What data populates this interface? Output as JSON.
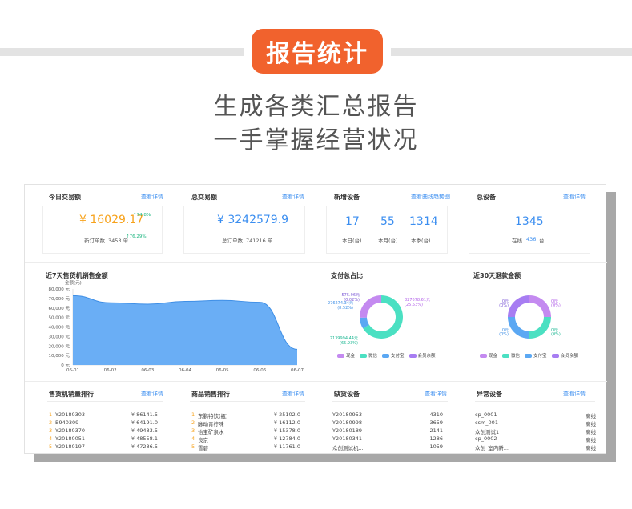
{
  "header": {
    "badge": "报告统计",
    "line1": "生成各类汇总报告",
    "line2": "一手掌握经营状况"
  },
  "stats": {
    "today": {
      "title": "今日交易额",
      "link": "查看详情",
      "amount": "¥ 16029.17",
      "up": "↑74.8%",
      "orders_label": "新订单数",
      "orders": "3453 单",
      "orders_up": "↑76.29%"
    },
    "total": {
      "title": "总交易额",
      "link": "查看详情",
      "amount": "¥ 3242579.9",
      "orders_label": "总订单数",
      "orders": "741216 单"
    },
    "new_devices": {
      "title": "新增设备",
      "link": "查看曲线趋势图",
      "values": [
        "17",
        "55",
        "1314"
      ],
      "labels": [
        "本日(台)",
        "本月(台)",
        "本季(台)"
      ]
    },
    "all_devices": {
      "title": "总设备",
      "link": "查看详情",
      "value": "1345",
      "online_label": "在线",
      "online": "436",
      "unit": "台"
    }
  },
  "sales_chart": {
    "title": "近7天售货机销售金额",
    "unit_label": "金额(元)",
    "y_ticks": [
      "80,000 元",
      "70,000 元",
      "60,000 元",
      "50,000 元",
      "40,000 元",
      "30,000 元",
      "20,000 元",
      "10,000 元",
      "0 元"
    ],
    "x_ticks": [
      "06-01",
      "06-02",
      "06-03",
      "06-04",
      "06-05",
      "06-06",
      "06-07"
    ]
  },
  "chart_data": [
    {
      "type": "area",
      "title": "近7天售货机销售金额",
      "ylabel": "金额(元)",
      "categories": [
        "06-01",
        "06-02",
        "06-03",
        "06-04",
        "06-05",
        "06-06",
        "06-07"
      ],
      "values": [
        73000,
        65500,
        64000,
        67000,
        68000,
        66000,
        16500
      ],
      "ylim": [
        0,
        80000
      ],
      "color": "#6aaef5"
    },
    {
      "type": "pie",
      "title": "支付总占比",
      "labels": [
        "现金",
        "微信",
        "支付宝",
        "会员余额"
      ],
      "values": [
        575.96,
        2139994.44,
        276274.34,
        827678.61
      ],
      "data_labels": [
        "575.96元 (0.02%)",
        "2139994.44元 (65.93%)",
        "276274.34元 (8.52%)",
        "827678.61元 (25.53%)"
      ],
      "colors": [
        "#a77df2",
        "#4be0c2",
        "#5ba8f3",
        "#c48af0"
      ]
    },
    {
      "type": "pie",
      "title": "近30天退款金额",
      "labels": [
        "现金",
        "微信",
        "支付宝",
        "会员余额"
      ],
      "values": [
        0.25,
        0.25,
        0.25,
        0.25
      ],
      "data_labels": [
        "0元 (0%)",
        "0元 (0%)",
        "0元 (0%)",
        "0元 (0%)"
      ],
      "colors": [
        "#c48af0",
        "#4be0c2",
        "#5ba8f3",
        "#a77df2"
      ]
    }
  ],
  "pie_pay": {
    "title": "支付总占比",
    "labels": [
      "575.96元",
      "(0.02%)",
      "276274.34元",
      "(8.52%)",
      "827678.61元",
      "(25.53%)",
      "2139994.44元",
      "(65.93%)"
    ],
    "legend": [
      "现金",
      "微信",
      "支付宝",
      "会员余额"
    ]
  },
  "pie_refund": {
    "title": "近30天退款金额",
    "labels": [
      "0元",
      "(0%)",
      "0元",
      "(0%)",
      "0元",
      "(0%)",
      "0元",
      "(0%)"
    ],
    "legend": [
      "现金",
      "微信",
      "支付宝",
      "会员余额"
    ]
  },
  "rank_machines": {
    "title": "售货机销量排行",
    "link": "查看详情",
    "rows": [
      {
        "rank": "1",
        "name": "Y20180303",
        "value": "¥ 86141.5"
      },
      {
        "rank": "2",
        "name": "B940309",
        "value": "¥ 64191.0"
      },
      {
        "rank": "3",
        "name": "Y20180370",
        "value": "¥ 49483.5"
      },
      {
        "rank": "4",
        "name": "Y20180051",
        "value": "¥ 48558.1"
      },
      {
        "rank": "5",
        "name": "Y20180197",
        "value": "¥ 47286.5"
      }
    ]
  },
  "rank_products": {
    "title": "商品销售排行",
    "link": "查看详情",
    "rows": [
      {
        "rank": "1",
        "name": "东鹏特饮(瓶)",
        "value": "¥ 25102.0"
      },
      {
        "rank": "2",
        "name": "脉动青柠味",
        "value": "¥ 16112.0"
      },
      {
        "rank": "3",
        "name": "怡宝矿泉水",
        "value": "¥ 15378.0"
      },
      {
        "rank": "4",
        "name": "良京",
        "value": "¥ 12784.0"
      },
      {
        "rank": "5",
        "name": "雪碧",
        "value": "¥ 11761.0"
      }
    ]
  },
  "stock_out": {
    "title": "缺货设备",
    "link": "查看详情",
    "rows": [
      {
        "name": "Y20180953",
        "value": "4310"
      },
      {
        "name": "Y20180998",
        "value": "3659"
      },
      {
        "name": "Y20180189",
        "value": "2141"
      },
      {
        "name": "Y20180341",
        "value": "1286"
      },
      {
        "name": "众创测试机...",
        "value": "1059"
      }
    ]
  },
  "abnormal": {
    "title": "异常设备",
    "link": "查看详情",
    "rows": [
      {
        "name": "cp_0001",
        "status": "离线"
      },
      {
        "name": "csm_001",
        "status": "离线"
      },
      {
        "name": "众创测试1",
        "status": "离线"
      },
      {
        "name": "cp_0002",
        "status": "离线"
      },
      {
        "name": "众创_室内新...",
        "status": "离线"
      }
    ]
  }
}
